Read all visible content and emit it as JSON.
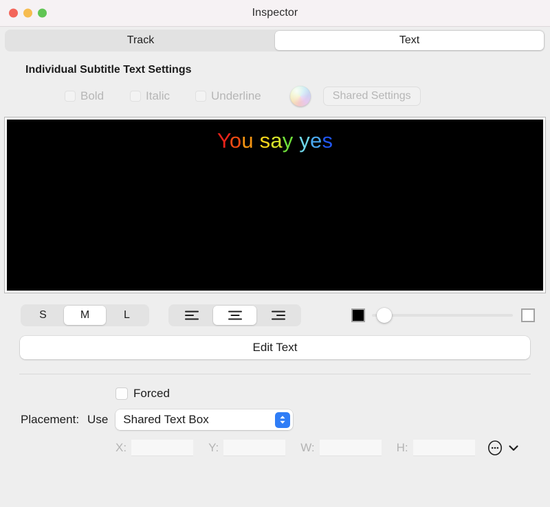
{
  "window": {
    "title": "Inspector",
    "traffic_lights": [
      {
        "name": "close",
        "color": "#f3655a"
      },
      {
        "name": "minimize",
        "color": "#f6bc4f"
      },
      {
        "name": "zoom",
        "color": "#61c554"
      }
    ]
  },
  "tabs": [
    {
      "label": "Track",
      "selected": false
    },
    {
      "label": "Text",
      "selected": true
    }
  ],
  "section": {
    "title": "Individual Subtitle Text Settings"
  },
  "style_row": {
    "bold": {
      "label": "Bold",
      "checked": false,
      "disabled": true
    },
    "italic": {
      "label": "Italic",
      "checked": false,
      "disabled": true
    },
    "underline": {
      "label": "Underline",
      "checked": false,
      "disabled": true
    },
    "color_well": {
      "name": "color-well",
      "disabled": true
    },
    "shared_settings": {
      "label": "Shared Settings",
      "disabled": true
    }
  },
  "preview": {
    "background": "#000000",
    "text": "You say yes",
    "letters": [
      {
        "char": "Y",
        "color": "#e8231a"
      },
      {
        "char": "o",
        "color": "#ef4a13"
      },
      {
        "char": "u",
        "color": "#f79512"
      },
      {
        "char": " ",
        "color": "#000000"
      },
      {
        "char": "s",
        "color": "#f5d41a"
      },
      {
        "char": "a",
        "color": "#d7e32a"
      },
      {
        "char": "y",
        "color": "#6ede3a"
      },
      {
        "char": " ",
        "color": "#000000"
      },
      {
        "char": "y",
        "color": "#6fd6ea"
      },
      {
        "char": "e",
        "color": "#4aa8f0"
      },
      {
        "char": "s",
        "color": "#2056f2"
      }
    ]
  },
  "size_segments": [
    {
      "label": "S",
      "selected": false
    },
    {
      "label": "M",
      "selected": true
    },
    {
      "label": "L",
      "selected": false
    }
  ],
  "align_segments": [
    {
      "icon": "align-left-icon",
      "label": "Align Left",
      "selected": false
    },
    {
      "icon": "align-center-icon",
      "label": "Align Center",
      "selected": true
    },
    {
      "icon": "align-right-icon",
      "label": "Align Right",
      "selected": false
    }
  ],
  "opacity_slider": {
    "left_swatch": "#000000",
    "right_swatch": "#ffffff",
    "value": 2,
    "min": 0,
    "max": 100
  },
  "edit_text_button": {
    "label": "Edit Text"
  },
  "forced": {
    "label": "Forced",
    "checked": false
  },
  "placement": {
    "label": "Placement:",
    "use_label": "Use",
    "selected_option": "Shared Text Box",
    "options": [
      "Shared Text Box"
    ]
  },
  "coords": {
    "fields": [
      {
        "label": "X:",
        "value": "",
        "placeholder": "",
        "disabled": true
      },
      {
        "label": "Y:",
        "value": "",
        "placeholder": "",
        "disabled": true
      },
      {
        "label": "W:",
        "value": "",
        "placeholder": "",
        "disabled": true
      },
      {
        "label": "H:",
        "value": "",
        "placeholder": "",
        "disabled": true
      }
    ],
    "more_icon": "ellipsis-circle-icon",
    "chevron_icon": "chevron-down-icon"
  }
}
